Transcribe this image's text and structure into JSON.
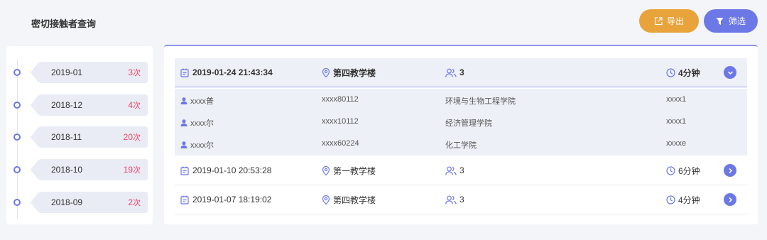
{
  "page_title": "密切接触者查询",
  "toolbar": {
    "export_label": "导出",
    "filter_label": "筛选"
  },
  "timeline": [
    {
      "month": "2019-01",
      "count": "3",
      "unit": "次"
    },
    {
      "month": "2018-12",
      "count": "4",
      "unit": "次"
    },
    {
      "month": "2018-11",
      "count": "20",
      "unit": "次"
    },
    {
      "month": "2018-10",
      "count": "19",
      "unit": "次"
    },
    {
      "month": "2018-09",
      "count": "2",
      "unit": "次"
    }
  ],
  "records": [
    {
      "time": "2019-01-24 21:43:34",
      "place": "第四教学楼",
      "people": "3",
      "duration": "4分钟",
      "details": [
        {
          "name": "xxxx普",
          "id": "xxxx80112",
          "college": "环境与生物工程学院",
          "class": "xxxx1"
        },
        {
          "name": "xxxx尔",
          "id": "xxxx10112",
          "college": "经济管理学院",
          "class": "xxxx1"
        },
        {
          "name": "xxxx尔",
          "id": "xxxx60224",
          "college": "化工学院",
          "class": "xxxxe"
        }
      ]
    },
    {
      "time": "2019-01-10 20:53:28",
      "place": "第一教学楼",
      "people": "3",
      "duration": "6分钟"
    },
    {
      "time": "2019-01-07 18:19:02",
      "place": "第四教学楼",
      "people": "3",
      "duration": "4分钟"
    }
  ],
  "colors": {
    "accent": "#6c78e6",
    "export": "#e8a33a",
    "count": "#e8486a"
  }
}
